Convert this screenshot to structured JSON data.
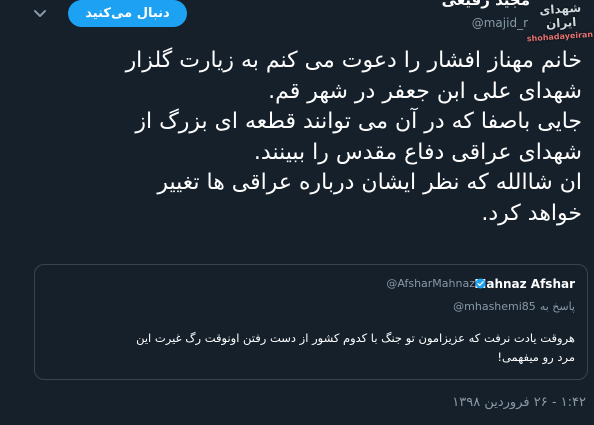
{
  "header": {
    "author_name": "مجید رفیعی",
    "author_handle": "@majid_r",
    "follow_label": "دنبال می‌کنید",
    "watermark_line1": "شهدای ایران",
    "watermark_line2": "shohadayeiran"
  },
  "tweet": {
    "lines": [
      "خانم مهناز افشار را دعوت می کنم به زیارت گلزار",
      "شهدای علی ابن جعفر در شهر قم.",
      "جایی باصفا که در آن می توانند قطعه ای بزرگ از",
      "شهدای عراقی دفاع مقدس را ببینند.",
      "ان شاالله که نظر ایشان درباره عراقی ها تغییر",
      "خواهد کرد."
    ]
  },
  "quote": {
    "name": "Mahnaz Afshar",
    "handle": "@AfsharMahnaz",
    "reply_prefix": "پاسخ به",
    "reply_handle": "@mhashemi85",
    "body_lines": [
      "هروقت یادت نرفت که عزیزامون تو جنگ با کدوم کشور از دست رفتن اونوقت رگ غیرت این",
      "مرد رو میفهمی!"
    ]
  },
  "timestamp": "۱:۴۲ - ۲۶ فروردین ۱۳۹۸",
  "colors": {
    "background": "#15202b",
    "accent": "#1da1f2",
    "muted": "#8899a6",
    "border": "#38444d"
  },
  "icons": {
    "chevron": "chevron-down-icon",
    "verified": "verified-badge-icon"
  }
}
